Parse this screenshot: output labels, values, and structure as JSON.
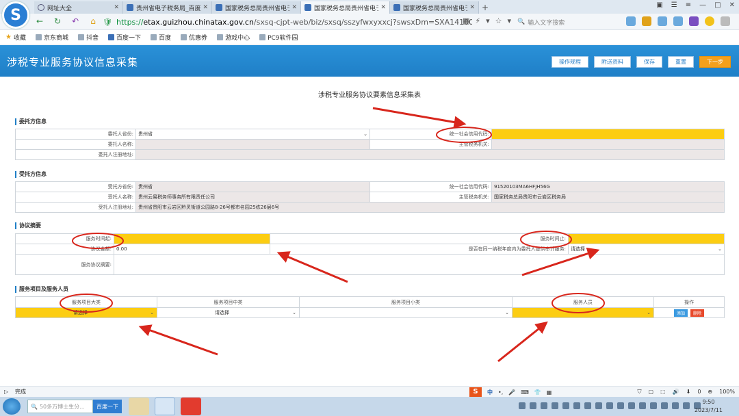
{
  "browser": {
    "tabs": [
      {
        "label": "网址大全",
        "active": false,
        "icon": "globe-icon"
      },
      {
        "label": "贵州省电子税务局_百度",
        "active": false,
        "icon": "paw-icon"
      },
      {
        "label": "国家税务总局贵州省电子",
        "active": false,
        "icon": "tax-icon"
      },
      {
        "label": "国家税务总局贵州省电子",
        "active": true,
        "icon": "tax-icon"
      },
      {
        "label": "国家税务总局贵州省电子",
        "active": false,
        "icon": "tax-icon"
      }
    ],
    "url_scheme": "https://",
    "url_host": "etax.guizhou.chinatax.gov.cn",
    "url_path": "/sxsq-cjpt-web/biz/sxsq/sszyfwxyxxcj?swsxDm=SXA141008001&y",
    "search_placeholder": "输入文字搜索",
    "bookmarks": [
      "收藏",
      "京东商城",
      "抖音",
      "百度一下",
      "百度",
      "优惠券",
      "游戏中心",
      "PC9软件园"
    ]
  },
  "header": {
    "title": "涉税专业服务协议信息采集",
    "buttons": {
      "rules": "操作规程",
      "attach": "附送资料",
      "save": "保存",
      "reset": "重置",
      "next": "下一步"
    }
  },
  "form_title": "涉税专业服务协议要素信息采集表",
  "client": {
    "heading": "委托方信息",
    "province_label": "委托人省份:",
    "province_value": "贵州省",
    "credit_label": "统一社会信用代码:",
    "credit_value": "",
    "name_label": "委托人名称:",
    "name_value": "",
    "tax_office_label": "主管税务机关:",
    "tax_office_value": "",
    "address_label": "委托人注册地址:",
    "address_value": ""
  },
  "agent": {
    "heading": "受托方信息",
    "province_label": "受托方省份:",
    "province_value": "贵州省",
    "credit_label": "统一社会信用代码:",
    "credit_value": "91520103MA6HFJH56G",
    "name_label": "受托人名称:",
    "name_value": "贵州云易税务师事务所有限责任公司",
    "tax_office_label": "主管税务机关:",
    "tax_office_value": "国家税务总局贵阳市云岩区税务局",
    "address_label": "受托人注册地址:",
    "address_value": "贵州省贵阳市云岩区黔灵街道公园路8-26号都市名园25栋26层6号"
  },
  "agreement": {
    "heading": "协议摘要",
    "start_label": "服务时间起:",
    "start_value": "",
    "end_label": "服务时间止:",
    "end_value": "",
    "amount_label": "协议金额:",
    "amount_value": "0.00",
    "annual_label": "是否在同一纳税年度内为委托人提供审计服务:",
    "annual_value": "请选择",
    "summary_label": "服务协议摘要:",
    "summary_value": ""
  },
  "services": {
    "heading": "服务项目及服务人员",
    "columns": [
      "服务项目大类",
      "服务项目中类",
      "服务项目小类",
      "服务人员",
      "操作"
    ],
    "row": {
      "major": "请选择",
      "middle": "请选择",
      "minor": "",
      "staff": "",
      "add": "添加",
      "delete": "删除"
    }
  },
  "statusbar": {
    "text": "完成",
    "zoom": "100%",
    "downloads": "0"
  },
  "taskbar": {
    "search_placeholder": "50多万博士生分...",
    "search_button": "百度一下",
    "time": "9:50",
    "date": "2023/7/11"
  },
  "colors": {
    "header_blue": "#1f7fc7",
    "required_yellow": "#fccd12",
    "next_orange": "#f4a01c",
    "annotation_red": "#d8261c"
  }
}
